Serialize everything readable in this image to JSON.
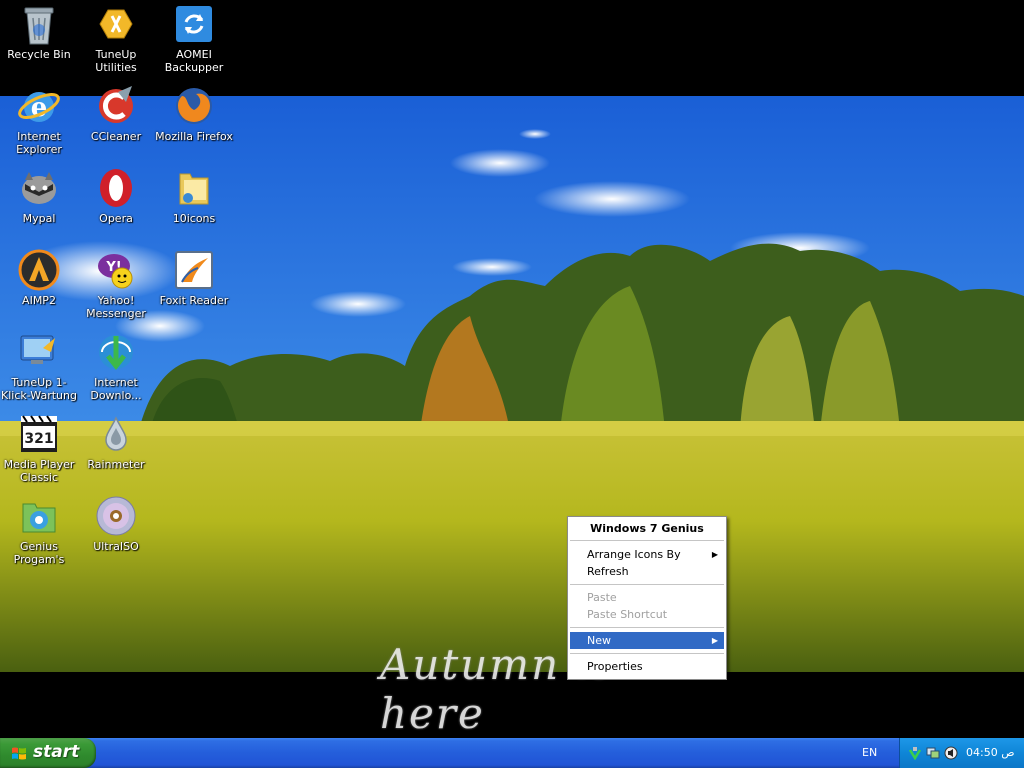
{
  "desktop": {
    "icons": [
      {
        "label": "Recycle Bin",
        "icon": "recycle-bin-icon"
      },
      {
        "label": "TuneUp Utilities",
        "icon": "tuneup-utilities-icon"
      },
      {
        "label": "AOMEI Backupper",
        "icon": "aomei-backupper-icon"
      },
      {
        "label": "Internet Explorer",
        "icon": "internet-explorer-icon"
      },
      {
        "label": "CCleaner",
        "icon": "ccleaner-icon"
      },
      {
        "label": "Mozilla Firefox",
        "icon": "firefox-icon"
      },
      {
        "label": "Mypal",
        "icon": "mypal-icon"
      },
      {
        "label": "Opera",
        "icon": "opera-icon"
      },
      {
        "label": "10icons",
        "icon": "folder-icon"
      },
      {
        "label": "AIMP2",
        "icon": "aimp-icon"
      },
      {
        "label": "Yahoo! Messenger",
        "icon": "yahoo-messenger-icon"
      },
      {
        "label": "Foxit Reader",
        "icon": "foxit-reader-icon"
      },
      {
        "label": "TuneUp 1-Klick-Wartung",
        "icon": "tuneup-oneclick-icon"
      },
      {
        "label": "Internet Downlo...",
        "icon": "internet-download-manager-icon"
      },
      {
        "label": "Media Player Classic",
        "icon": "media-player-classic-icon"
      },
      {
        "label": "Rainmeter",
        "icon": "rainmeter-icon"
      },
      {
        "label": "Genius Progam's",
        "icon": "genius-programs-icon"
      },
      {
        "label": "UltraISO",
        "icon": "ultraiso-icon"
      }
    ],
    "wallpaper_caption": "Autumn is here"
  },
  "context_menu": {
    "header": "Windows 7 Genius",
    "items": {
      "arrange": "Arrange Icons By",
      "refresh": "Refresh",
      "paste": "Paste",
      "paste_shortcut": "Paste Shortcut",
      "new": "New",
      "properties": "Properties"
    },
    "submenu_arrow": "▶"
  },
  "taskbar": {
    "start_label": "start",
    "language": "EN",
    "clock": "04:50 ص"
  },
  "colors": {
    "taskbar_blue": "#245edb",
    "start_green": "#3b9a37",
    "menu_highlight": "#316ac5",
    "tray_blue": "#0f86d7"
  }
}
